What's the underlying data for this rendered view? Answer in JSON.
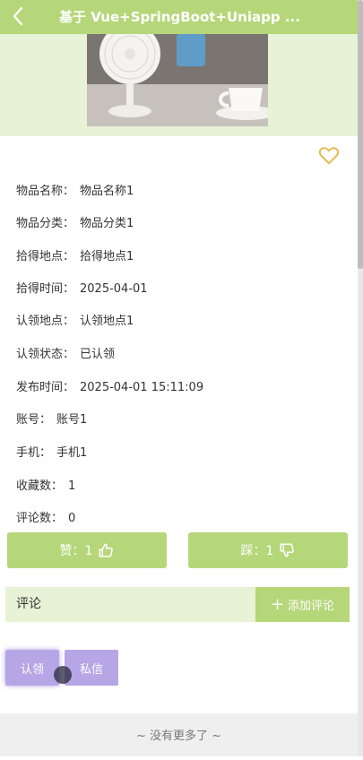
{
  "nav": {
    "title": "基于 Vue+SpringBoot+Uniapp ..."
  },
  "hero": {
    "photo_caption": ""
  },
  "details": {
    "item_name": {
      "label": "物品名称：",
      "value": "物品名称1"
    },
    "item_category": {
      "label": "物品分类：",
      "value": "物品分类1"
    },
    "found_place": {
      "label": "拾得地点：",
      "value": "拾得地点1"
    },
    "found_time": {
      "label": "拾得时间：",
      "value": "2025-04-01"
    },
    "claim_place": {
      "label": "认领地点：",
      "value": "认领地点1"
    },
    "claim_status": {
      "label": "认领状态：",
      "value": "已认领"
    },
    "publish_time": {
      "label": "发布时间：",
      "value": "2025-04-01 15:11:09"
    },
    "account": {
      "label": "账号：",
      "value": "账号1"
    },
    "phone": {
      "label": "手机：",
      "value": "手机1"
    },
    "favorites": {
      "label": "收藏数：",
      "value": "1"
    },
    "comments": {
      "label": "评论数：",
      "value": "0"
    }
  },
  "votes": {
    "like": {
      "label": "赞：1"
    },
    "dislike": {
      "label": "踩：1"
    }
  },
  "comment_section": {
    "label": "评论",
    "add_label": "添加评论",
    "add_plus": "+"
  },
  "actions": {
    "claim_label": "认领",
    "message_label": "私信"
  },
  "footer": {
    "text": "~ 没有更多了 ~"
  },
  "colors": {
    "primary": "#b6d67a",
    "light": "#e8f2d6",
    "purple": "#b6a6e6",
    "heart": "#e6b84a"
  }
}
